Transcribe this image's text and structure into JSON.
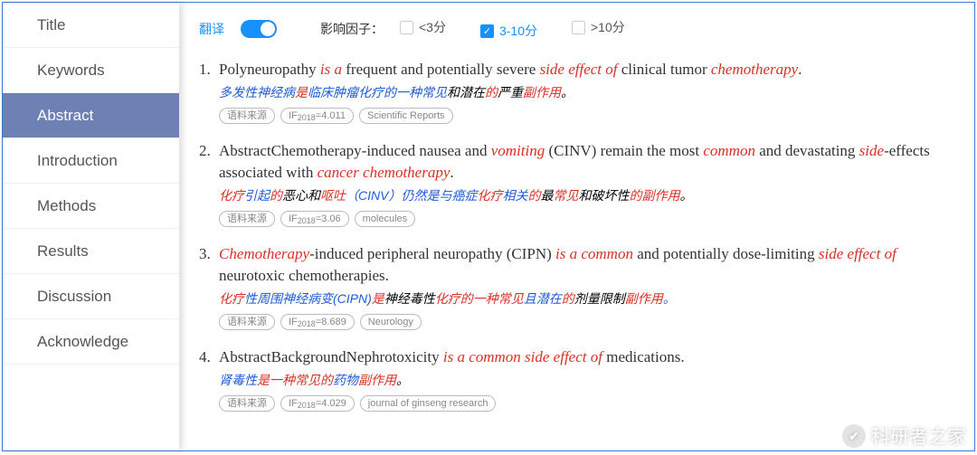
{
  "sidebar": {
    "items": [
      {
        "label": "Title"
      },
      {
        "label": "Keywords"
      },
      {
        "label": "Abstract"
      },
      {
        "label": "Introduction"
      },
      {
        "label": "Methods"
      },
      {
        "label": "Results"
      },
      {
        "label": "Discussion"
      },
      {
        "label": "Acknowledge"
      }
    ],
    "active_index": 2
  },
  "toolbar": {
    "translate_label": "翻译",
    "translate_on": true,
    "factor_label": "影响因子：",
    "options": [
      {
        "label": "<3分",
        "checked": false
      },
      {
        "label": "3-10分",
        "checked": true
      },
      {
        "label": ">10分",
        "checked": false
      }
    ]
  },
  "results": [
    {
      "num": "1.",
      "segments": [
        {
          "t": "Polyneuropathy ",
          "c": ""
        },
        {
          "t": "is a",
          "c": "r"
        },
        {
          "t": " frequent and potentially severe ",
          "c": ""
        },
        {
          "t": "side effect of",
          "c": "r"
        },
        {
          "t": " clinical tumor ",
          "c": ""
        },
        {
          "t": "chemotherapy",
          "c": "r"
        },
        {
          "t": ".",
          "c": ""
        }
      ],
      "trans": [
        {
          "t": "多发性神经病",
          "c": "b"
        },
        {
          "t": "是",
          "c": "r"
        },
        {
          "t": "临床肿瘤化疗的一种常见",
          "c": "b"
        },
        {
          "t": "和潜在",
          "c": ""
        },
        {
          "t": "的",
          "c": "r"
        },
        {
          "t": "严重",
          "c": ""
        },
        {
          "t": "副作用",
          "c": "r"
        },
        {
          "t": "。",
          "c": ""
        }
      ],
      "tags": {
        "source": "语料来源",
        "if": "IF 2018 =4.011",
        "journal": "Scientific Reports"
      }
    },
    {
      "num": "2.",
      "segments": [
        {
          "t": "AbstractChemotherapy-induced nausea and ",
          "c": ""
        },
        {
          "t": "vomiting",
          "c": "r"
        },
        {
          "t": " (CINV) remain the most ",
          "c": ""
        },
        {
          "t": "common",
          "c": "r"
        },
        {
          "t": " and devastating ",
          "c": ""
        },
        {
          "t": "side",
          "c": "r"
        },
        {
          "t": "-effects associated with ",
          "c": ""
        },
        {
          "t": "cancer chemotherapy",
          "c": "r"
        },
        {
          "t": ".",
          "c": ""
        }
      ],
      "trans": [
        {
          "t": "化疗",
          "c": "r"
        },
        {
          "t": "引起",
          "c": "b"
        },
        {
          "t": "的",
          "c": "r"
        },
        {
          "t": "恶心和",
          "c": ""
        },
        {
          "t": "呕吐",
          "c": "r"
        },
        {
          "t": "（CINV）仍然是与癌症",
          "c": "b"
        },
        {
          "t": "化疗",
          "c": "r"
        },
        {
          "t": "相关",
          "c": "b"
        },
        {
          "t": "的",
          "c": "r"
        },
        {
          "t": "最",
          "c": ""
        },
        {
          "t": "常见",
          "c": "r"
        },
        {
          "t": "和破坏性",
          "c": ""
        },
        {
          "t": "的副作用",
          "c": "r"
        },
        {
          "t": "。",
          "c": ""
        }
      ],
      "tags": {
        "source": "语料来源",
        "if": "IF 2018 =3.06",
        "journal": "molecules"
      }
    },
    {
      "num": "3.",
      "segments": [
        {
          "t": "Chemotherapy",
          "c": "r"
        },
        {
          "t": "-induced peripheral neuropathy (CIPN) ",
          "c": ""
        },
        {
          "t": "is a common",
          "c": "r"
        },
        {
          "t": " and potentially dose-limiting ",
          "c": ""
        },
        {
          "t": "side effect of",
          "c": "r"
        },
        {
          "t": " neurotoxic chemotherapies.",
          "c": ""
        }
      ],
      "trans": [
        {
          "t": "化疗",
          "c": "r"
        },
        {
          "t": "性周围神经病变(CIPN)",
          "c": "b"
        },
        {
          "t": "是",
          "c": "r"
        },
        {
          "t": "神经毒性",
          "c": ""
        },
        {
          "t": "化疗的一种常见",
          "c": "r"
        },
        {
          "t": "且潜在",
          "c": "b"
        },
        {
          "t": "的",
          "c": "r"
        },
        {
          "t": "剂量限制",
          "c": ""
        },
        {
          "t": "副作用",
          "c": "r"
        },
        {
          "t": "。",
          "c": "b"
        }
      ],
      "tags": {
        "source": "语料来源",
        "if": "IF 2018 =8.689",
        "journal": "Neurology"
      }
    },
    {
      "num": "4.",
      "segments": [
        {
          "t": "AbstractBackgroundNephrotoxicity ",
          "c": ""
        },
        {
          "t": "is a common side effect of",
          "c": "r"
        },
        {
          "t": " medications.",
          "c": ""
        }
      ],
      "trans": [
        {
          "t": "肾毒性",
          "c": "b"
        },
        {
          "t": "是一种常见的",
          "c": "r"
        },
        {
          "t": "药物",
          "c": "b"
        },
        {
          "t": "副作用",
          "c": "r"
        },
        {
          "t": "。",
          "c": ""
        }
      ],
      "tags": {
        "source": "语料来源",
        "if": "IF 2018 =4.029",
        "journal": "journal of ginseng research"
      }
    }
  ],
  "watermark": {
    "text": "科研者之家",
    "icon": "✔"
  }
}
